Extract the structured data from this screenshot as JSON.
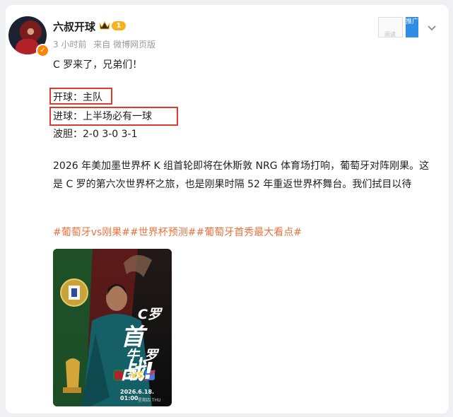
{
  "post": {
    "username": "六叔开球",
    "level": "1",
    "meta": {
      "time": "3 小时前",
      "source": "来自 微博网页版"
    },
    "ad": {
      "box_text": "阅读",
      "tag": "推广"
    },
    "lines": {
      "intro": "C 罗来了，兄弟们！",
      "kickoff": "开球：主队",
      "goal": "进球：上半场必有一球",
      "score": "波胆：2-0 3-0 3-1"
    },
    "paragraph": "2026 年美加墨世界杯 K 组首轮即将在休斯敦 NRG 体育场打响，葡萄牙对阵刚果。这是 C 罗的第六次世界杯之旅，也是刚果时隔 52 年重返世界杯舞台。我们拭目以待",
    "hashtags": [
      "#葡萄牙vs刚果#",
      "#世界杯预测#",
      "#葡萄牙首秀最大看点#"
    ],
    "poster": {
      "title_1": "C罗",
      "title_2": "首战!",
      "title_3": "牛,罗哥!",
      "vs": "VS",
      "date": "2026.6.18. 01:00",
      "day": "星期四 THU"
    }
  },
  "colors": {
    "accent_orange": "#eb7340",
    "highlight_red": "#e03a2f",
    "level_gold": "#f6b21c",
    "ad_blue": "#2e8be6"
  },
  "icons": [
    "crown-icon",
    "chevron-down-icon",
    "verified-badge-icon"
  ]
}
